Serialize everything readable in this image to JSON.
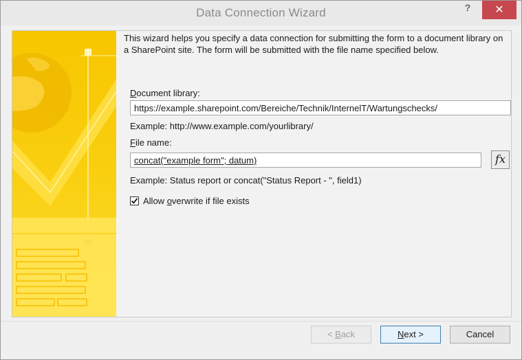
{
  "window": {
    "title": "Data Connection Wizard",
    "help_label": "?",
    "close_label": "✕"
  },
  "intro": {
    "text": "This wizard helps you specify a data connection for submitting the form to a document library on a SharePoint site. The form will be submitted with the file name specified below."
  },
  "document_library": {
    "label_accel": "D",
    "label_rest": "ocument library:",
    "value": "https://example.sharepoint.com/Bereiche/Technik/InternelT/Wartungschecks/",
    "example": "Example: http://www.example.com/yourlibrary/"
  },
  "file_name": {
    "label_accel": "F",
    "label_rest": "ile name:",
    "value": "concat(\"example form\"; datum)",
    "example": "Example: Status report or concat(\"Status Report - \", field1)",
    "fx_label": "fx"
  },
  "overwrite": {
    "checked": true,
    "label_pre": "Allow ",
    "label_accel": "o",
    "label_post": "verwrite if file exists"
  },
  "buttons": {
    "back_pre": "< ",
    "back_accel": "B",
    "back_post": "ack",
    "next_accel": "N",
    "next_post": "ext >",
    "cancel": "Cancel"
  },
  "colors": {
    "banner_yellow": "#f5c400",
    "banner_light": "#ffe760",
    "close_red": "#c7474e"
  }
}
